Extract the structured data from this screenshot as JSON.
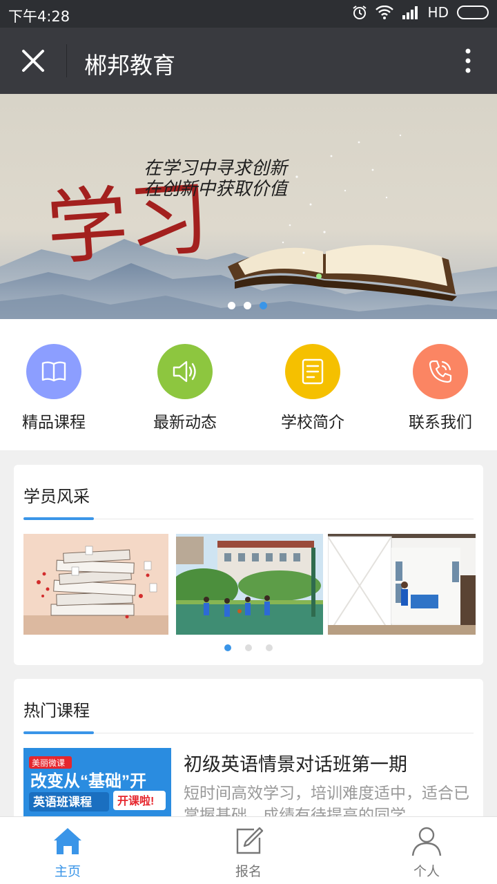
{
  "status": {
    "time": "下午4:28",
    "network": "HD"
  },
  "header": {
    "title": "郴邦教育"
  },
  "banner": {
    "big_char": "学习",
    "line1": "在学习中寻求创新",
    "line2": "在创新中获取价值"
  },
  "quick_links": [
    {
      "label": "精品课程",
      "icon": "book-icon",
      "color": "#8c9eff"
    },
    {
      "label": "最新动态",
      "icon": "speaker-icon",
      "color": "#8dc63f"
    },
    {
      "label": "学校简介",
      "icon": "document-icon",
      "color": "#f5c000"
    },
    {
      "label": "联系我们",
      "icon": "phone-icon",
      "color": "#fb8563"
    }
  ],
  "students": {
    "title": "学员风采"
  },
  "courses": {
    "title": "热门课程",
    "items": [
      {
        "title": "初级英语情景对话班第一期",
        "desc": "短时间高效学习，培训难度适中，适合已掌握基础，成绩有待提高的同学",
        "thumb_brand": "美丽微课",
        "thumb_line1": "改变从“基础”开",
        "thumb_line2": "英语班课程",
        "thumb_badge": "开课啦!"
      }
    ]
  },
  "tabs": [
    {
      "label": "主页",
      "icon": "home-icon",
      "active": true
    },
    {
      "label": "报名",
      "icon": "edit-icon",
      "active": false
    },
    {
      "label": "个人",
      "icon": "user-icon",
      "active": false
    }
  ],
  "colors": {
    "accent": "#3a95e8",
    "titlebar": "#393a3f"
  }
}
